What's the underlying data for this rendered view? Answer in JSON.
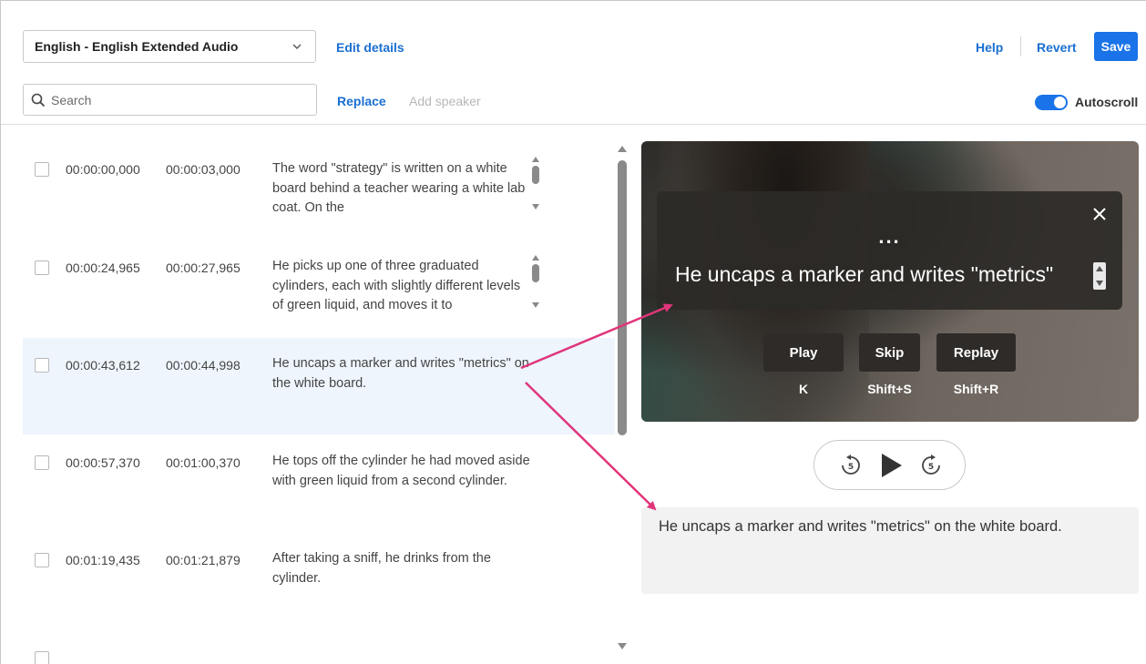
{
  "header": {
    "language_select": "English - English Extended Audio",
    "edit_details": "Edit details",
    "help": "Help",
    "revert": "Revert",
    "save": "Save"
  },
  "toolbar": {
    "search_placeholder": "Search",
    "replace": "Replace",
    "add_speaker": "Add speaker",
    "autoscroll": "Autoscroll",
    "autoscroll_on": true
  },
  "captions": [
    {
      "start": "00:00:00,000",
      "end": "00:00:03,000",
      "text": "The word \"strategy\" is written on a white board behind a teacher wearing a white lab coat. On the"
    },
    {
      "start": "00:00:24,965",
      "end": "00:00:27,965",
      "text": "He picks up one of three graduated cylinders, each with slightly different levels of green liquid, and moves it to"
    },
    {
      "start": "00:00:43,612",
      "end": "00:00:44,998",
      "text": "He uncaps a marker and writes \"metrics\" on the white board.",
      "selected": true
    },
    {
      "start": "00:00:57,370",
      "end": "00:01:00,370",
      "text": "He tops off the cylinder he had moved aside with green liquid from a second cylinder."
    },
    {
      "start": "00:01:19,435",
      "end": "00:01:21,879",
      "text": "After taking a sniff, he drinks from the cylinder."
    }
  ],
  "video": {
    "ellipsis": "...",
    "caption": "He uncaps a marker and writes \"metrics\"",
    "buttons": [
      {
        "label": "Play",
        "key": "K"
      },
      {
        "label": "Skip",
        "key": "Shift+S"
      },
      {
        "label": "Replay",
        "key": "Shift+R"
      }
    ]
  },
  "player": {
    "rewind_seconds": "5",
    "forward_seconds": "5"
  },
  "preview_text": "He uncaps a marker and writes \"metrics\" on the white board.",
  "colors": {
    "accent": "#1a73e8",
    "link": "#1a6fd1",
    "annotation_arrow": "#e0357a",
    "selected_row": "#eef5fd"
  }
}
